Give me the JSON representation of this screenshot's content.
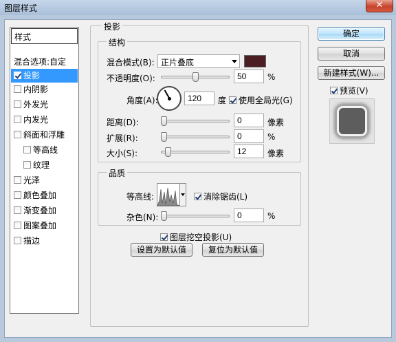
{
  "window": {
    "title": "图层样式",
    "close": "✕"
  },
  "stylelist": {
    "header": "样式",
    "items": [
      {
        "label": "混合选项:自定",
        "checkbox": false,
        "checked": false,
        "selected": false,
        "indent": false
      },
      {
        "label": "投影",
        "checkbox": true,
        "checked": true,
        "selected": true,
        "indent": false
      },
      {
        "label": "内阴影",
        "checkbox": true,
        "checked": false,
        "selected": false,
        "indent": false
      },
      {
        "label": "外发光",
        "checkbox": true,
        "checked": false,
        "selected": false,
        "indent": false
      },
      {
        "label": "内发光",
        "checkbox": true,
        "checked": false,
        "selected": false,
        "indent": false
      },
      {
        "label": "斜面和浮雕",
        "checkbox": true,
        "checked": false,
        "selected": false,
        "indent": false
      },
      {
        "label": "等高线",
        "checkbox": true,
        "checked": false,
        "selected": false,
        "indent": true
      },
      {
        "label": "纹理",
        "checkbox": true,
        "checked": false,
        "selected": false,
        "indent": true
      },
      {
        "label": "光泽",
        "checkbox": true,
        "checked": false,
        "selected": false,
        "indent": false
      },
      {
        "label": "颜色叠加",
        "checkbox": true,
        "checked": false,
        "selected": false,
        "indent": false
      },
      {
        "label": "渐变叠加",
        "checkbox": true,
        "checked": false,
        "selected": false,
        "indent": false
      },
      {
        "label": "图案叠加",
        "checkbox": true,
        "checked": false,
        "selected": false,
        "indent": false
      },
      {
        "label": "描边",
        "checkbox": true,
        "checked": false,
        "selected": false,
        "indent": false
      }
    ]
  },
  "drop_shadow": {
    "group_title": "投影",
    "structure": {
      "title": "结构",
      "blend_mode_label": "混合模式(B):",
      "blend_mode_value": "正片叠底",
      "color": "#4a1e22",
      "opacity_label": "不透明度(O):",
      "opacity_value": "50",
      "opacity_unit": "%",
      "opacity_fraction": 0.5,
      "angle_label": "角度(A):",
      "angle_value": "120",
      "angle_unit": "度",
      "global_light_label": "使用全局光(G)",
      "global_light_checked": true,
      "distance_label": "距离(D):",
      "distance_value": "0",
      "distance_unit": "像素",
      "spread_label": "扩展(R):",
      "spread_value": "0",
      "spread_unit": "%",
      "size_label": "大小(S):",
      "size_value": "12",
      "size_unit": "像素"
    },
    "quality": {
      "title": "品质",
      "contour_label": "等高线:",
      "antialias_label": "消除锯齿(L)",
      "antialias_checked": true,
      "noise_label": "杂色(N):",
      "noise_value": "0",
      "noise_unit": "%"
    },
    "knockout_label": "图层挖空投影(U)",
    "knockout_checked": true,
    "set_default": "设置为默认值",
    "reset_default": "复位为默认值"
  },
  "buttons": {
    "ok": "确定",
    "cancel": "取消",
    "new_style": "新建样式(W)...",
    "preview_label": "预览(V)",
    "preview_checked": true
  }
}
